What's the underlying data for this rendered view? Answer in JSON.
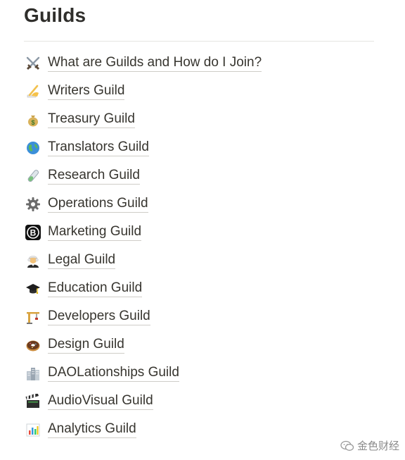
{
  "page": {
    "title": "Guilds"
  },
  "guilds": [
    {
      "label": "What are Guilds and How do I Join?",
      "icon": "crossed-swords-icon"
    },
    {
      "label": "Writers Guild",
      "icon": "writing-hand-icon"
    },
    {
      "label": "Treasury Guild",
      "icon": "money-bag-icon"
    },
    {
      "label": "Translators Guild",
      "icon": "globe-icon"
    },
    {
      "label": "Research Guild",
      "icon": "test-tube-icon"
    },
    {
      "label": "Operations Guild",
      "icon": "gear-icon"
    },
    {
      "label": "Marketing Guild",
      "icon": "bitcoin-icon"
    },
    {
      "label": "Legal Guild",
      "icon": "judge-icon"
    },
    {
      "label": "Education Guild",
      "icon": "graduation-cap-icon"
    },
    {
      "label": "Developers Guild",
      "icon": "crane-icon"
    },
    {
      "label": "Design Guild",
      "icon": "donut-icon"
    },
    {
      "label": "DAOLationships Guild",
      "icon": "buildings-icon"
    },
    {
      "label": "AudioVisual Guild",
      "icon": "clapper-board-icon"
    },
    {
      "label": "Analytics Guild",
      "icon": "bar-chart-icon"
    }
  ],
  "watermark": {
    "text": "金色财经",
    "icon": "wechat-icon"
  }
}
